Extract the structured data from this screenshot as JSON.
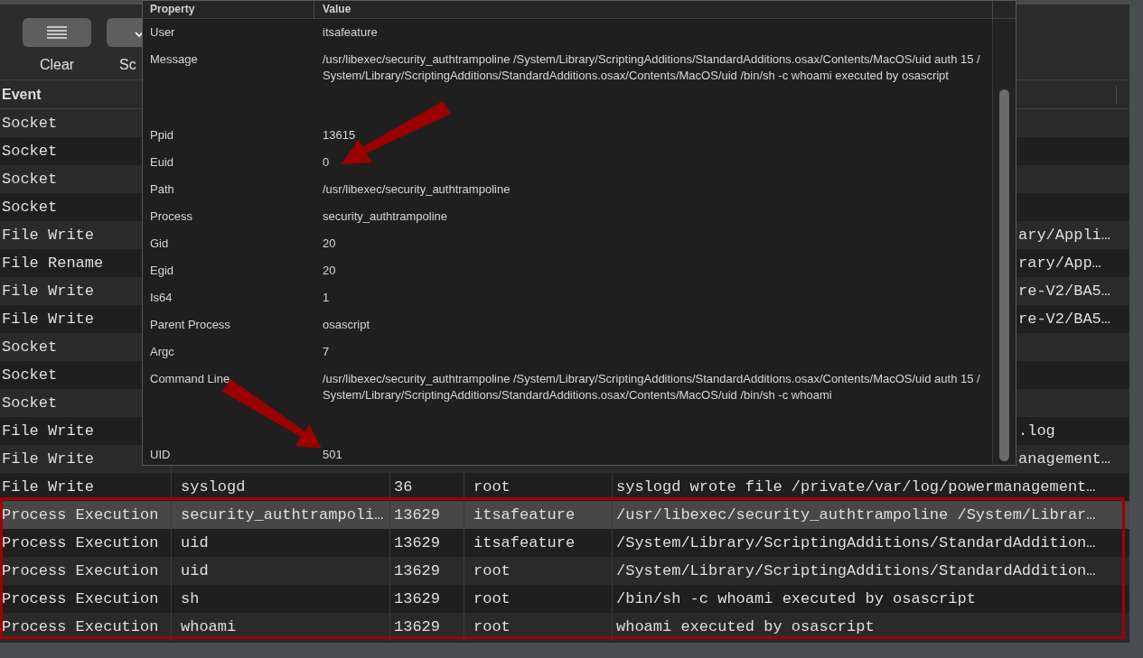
{
  "toolbar": {
    "buttons": [
      {
        "kind": "clear",
        "label": "Clear"
      },
      {
        "kind": "partial",
        "label": "Sc"
      }
    ]
  },
  "table": {
    "columns": [
      "Event"
    ],
    "rows": [
      {
        "event": "Socket",
        "selected": false
      },
      {
        "event": "Socket",
        "selected": false
      },
      {
        "event": "Socket",
        "selected": false
      },
      {
        "event": "Socket",
        "selected": false
      },
      {
        "event": "File Write",
        "message": "ary/Appli…",
        "selected": false
      },
      {
        "event": "File Rename",
        "message": "rary/App…",
        "selected": false
      },
      {
        "event": "File Write",
        "message": "re-V2/BA5…",
        "selected": false
      },
      {
        "event": "File Write",
        "message": "re-V2/BA5…",
        "selected": false
      },
      {
        "event": "Socket",
        "selected": false
      },
      {
        "event": "Socket",
        "selected": false
      },
      {
        "event": "Socket",
        "selected": false
      },
      {
        "event": "File Write",
        "message": ".log",
        "selected": false
      },
      {
        "event": "File Write",
        "message": "anagement…",
        "selected": false
      },
      {
        "event": "File Write",
        "process": "syslogd",
        "pid": "36",
        "user": "root",
        "message": "syslogd wrote file /private/var/log/powermanagement…",
        "selected": false
      },
      {
        "event": "Process Execution",
        "process": "security_authtrampoli…",
        "pid": "13629",
        "user": "itsafeature",
        "message": "/usr/libexec/security_authtrampoline /System/Librar…",
        "selected": true
      },
      {
        "event": "Process Execution",
        "process": "uid",
        "pid": "13629",
        "user": "itsafeature",
        "message": "/System/Library/ScriptingAdditions/StandardAddition…",
        "selected": false
      },
      {
        "event": "Process Execution",
        "process": "uid",
        "pid": "13629",
        "user": "root",
        "message": "/System/Library/ScriptingAdditions/StandardAddition…",
        "selected": false
      },
      {
        "event": "Process Execution",
        "process": "sh",
        "pid": "13629",
        "user": "root",
        "message": "/bin/sh -c whoami executed by osascript",
        "selected": false
      },
      {
        "event": "Process Execution",
        "process": "whoami",
        "pid": "13629",
        "user": "root",
        "message": "whoami executed by osascript",
        "selected": false
      }
    ]
  },
  "details": {
    "columns": [
      "Property",
      "Value"
    ],
    "rows": [
      {
        "property": "User",
        "value": "itsafeature"
      },
      {
        "property": "Message",
        "value": "/usr/libexec/security_authtrampoline /System/Library/ScriptingAdditions/StandardAdditions.osax/Contents/MacOS/uid auth 15 /System/Library/ScriptingAdditions/StandardAdditions.osax/Contents/MacOS/uid /bin/sh -c whoami executed by osascript"
      },
      {
        "property": "Ppid",
        "value": "13615"
      },
      {
        "property": "Euid",
        "value": "0"
      },
      {
        "property": "Path",
        "value": "/usr/libexec/security_authtrampoline"
      },
      {
        "property": "Process",
        "value": "security_authtrampoline"
      },
      {
        "property": "Gid",
        "value": "20"
      },
      {
        "property": "Egid",
        "value": "20"
      },
      {
        "property": "Is64",
        "value": "1"
      },
      {
        "property": "Parent Process",
        "value": "osascript"
      },
      {
        "property": "Argc",
        "value": "7"
      },
      {
        "property": "Command Line",
        "value": "/usr/libexec/security_authtrampoline /System/Library/ScriptingAdditions/StandardAdditions.osax/Contents/MacOS/uid auth 15 /System/Library/ScriptingAdditions/StandardAdditions.osax/Contents/MacOS/uid /bin/sh -c whoami"
      },
      {
        "property": "UID",
        "value": "501"
      }
    ]
  }
}
